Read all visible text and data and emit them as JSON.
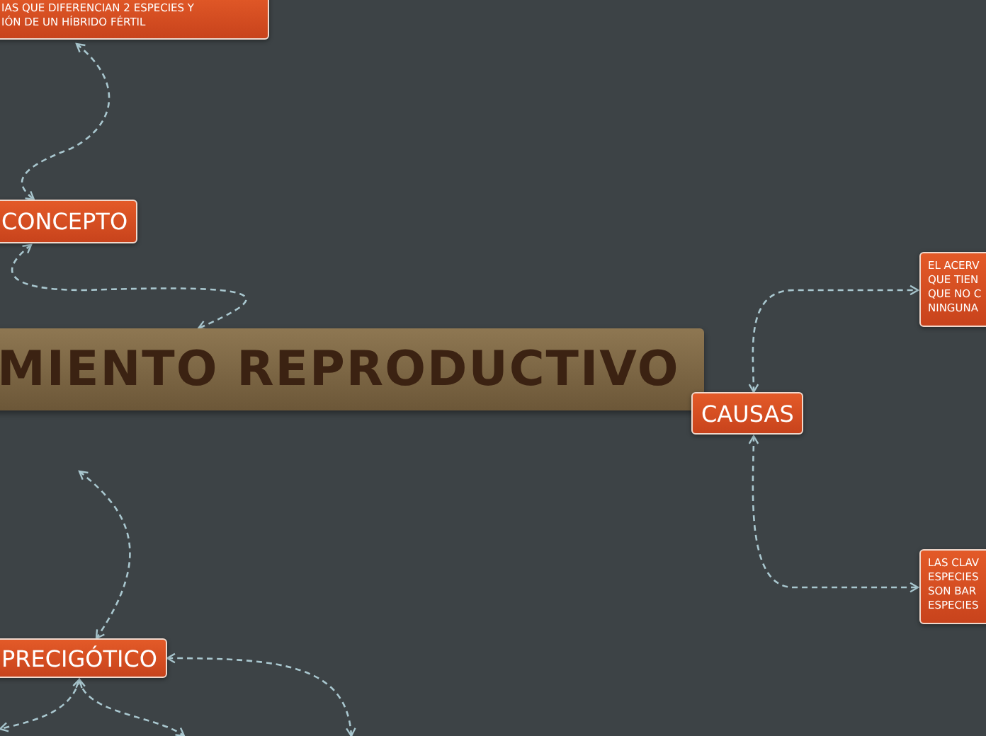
{
  "central_topic": "MIENTO REPRODUCTIVO",
  "topics": [
    {
      "kind": "note",
      "lines": [
        "IAS QUE DIFERENCIAN 2 ESPECIES Y",
        "IÓN DE UN HÍBRIDO FÉRTIL"
      ]
    },
    {
      "kind": "main",
      "lines": [
        "CONCEPTO"
      ]
    },
    {
      "kind": "main",
      "lines": [
        "CAUSAS"
      ]
    },
    {
      "kind": "note",
      "lines": [
        "EL ACERV",
        "QUE TIEN",
        "QUE NO C",
        "NINGUNA"
      ]
    },
    {
      "kind": "note",
      "lines": [
        "LAS CLAV",
        "ESPECIES",
        "SON BAR",
        "ESPECIES"
      ]
    },
    {
      "kind": "main",
      "lines": [
        "PRECIGÓTICO"
      ]
    }
  ]
}
